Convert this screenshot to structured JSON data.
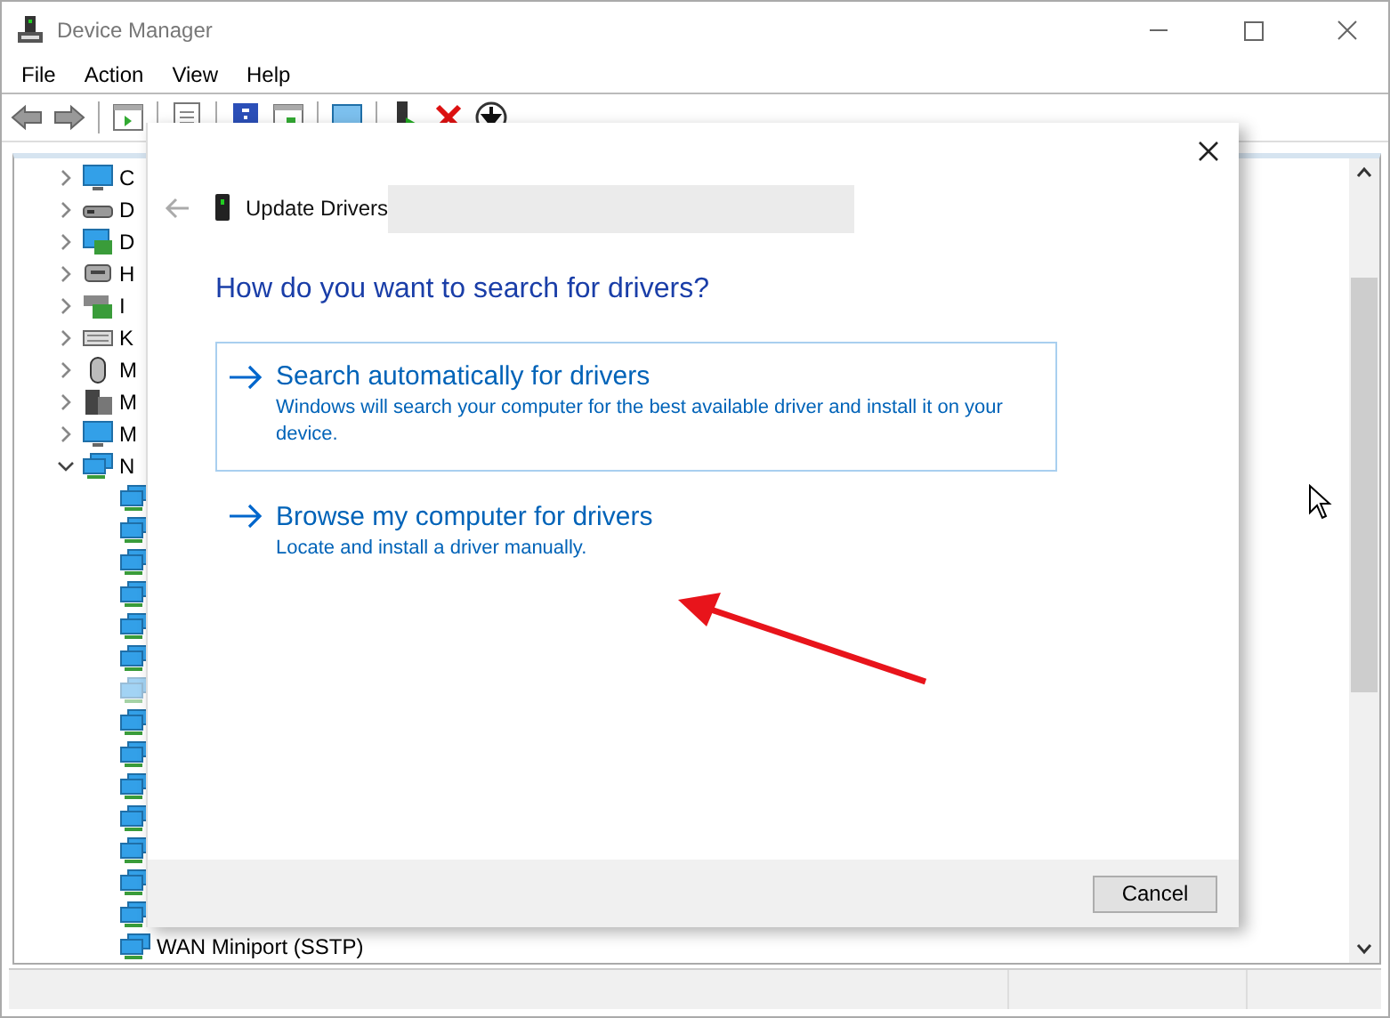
{
  "window": {
    "title": "Device Manager"
  },
  "menu": [
    "File",
    "Action",
    "View",
    "Help"
  ],
  "tree": [
    {
      "label": "C",
      "kind": "computer",
      "expanded": false
    },
    {
      "label": "D",
      "kind": "disk",
      "expanded": false
    },
    {
      "label": "D",
      "kind": "display",
      "expanded": false
    },
    {
      "label": "H",
      "kind": "hid",
      "expanded": false
    },
    {
      "label": "I",
      "kind": "ide",
      "expanded": false
    },
    {
      "label": "K",
      "kind": "keyboard",
      "expanded": false
    },
    {
      "label": "M",
      "kind": "mouse",
      "expanded": false
    },
    {
      "label": "M",
      "kind": "modem",
      "expanded": false
    },
    {
      "label": "M",
      "kind": "monitor",
      "expanded": false
    },
    {
      "label": "N",
      "kind": "network",
      "expanded": true,
      "children": [
        {
          "disabled": false
        },
        {
          "disabled": false
        },
        {
          "disabled": false
        },
        {
          "disabled": false
        },
        {
          "disabled": false
        },
        {
          "disabled": false
        },
        {
          "disabled": true
        },
        {
          "disabled": false
        },
        {
          "disabled": false
        },
        {
          "disabled": false
        },
        {
          "disabled": false
        },
        {
          "disabled": false
        },
        {
          "disabled": false
        },
        {
          "disabled": false
        },
        {
          "label": "WAN Miniport (SSTP)",
          "disabled": false
        }
      ]
    }
  ],
  "dialog": {
    "title": "Update Drivers",
    "heading": "How do you want to search for drivers?",
    "options": [
      {
        "title": "Search automatically for drivers",
        "description": "Windows will search your computer for the best available driver and install it on your device.",
        "highlighted": true
      },
      {
        "title": "Browse my computer for drivers",
        "description": "Locate and install a driver manually.",
        "highlighted": false
      }
    ],
    "buttons": [
      "Cancel"
    ]
  }
}
